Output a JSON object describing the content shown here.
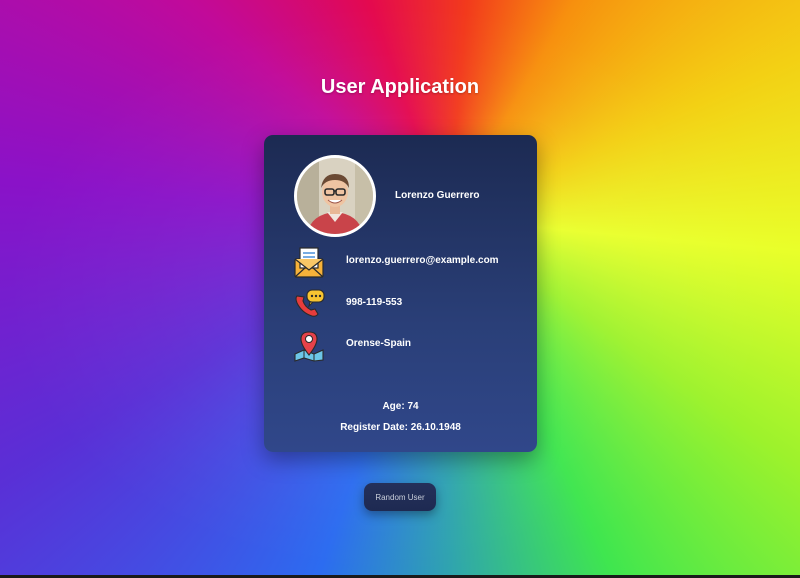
{
  "header": {
    "title": "User Application"
  },
  "profile": {
    "name": "Lorenzo Guerrero",
    "email": "lorenzo.guerrero@example.com",
    "phone": "998-119-553",
    "location": "Orense-Spain",
    "age_text": "Age: 74",
    "register_text": "Register Date: 26.10.1948"
  },
  "icons": {
    "email": "envelope-icon",
    "phone": "phone-call-icon",
    "location": "map-pin-icon"
  },
  "actions": {
    "random_label": "Random User"
  },
  "colors": {
    "card_top": "#1c2a52",
    "card_bottom": "#30478a",
    "text": "#ffffff",
    "button_bg": "#24305a"
  }
}
